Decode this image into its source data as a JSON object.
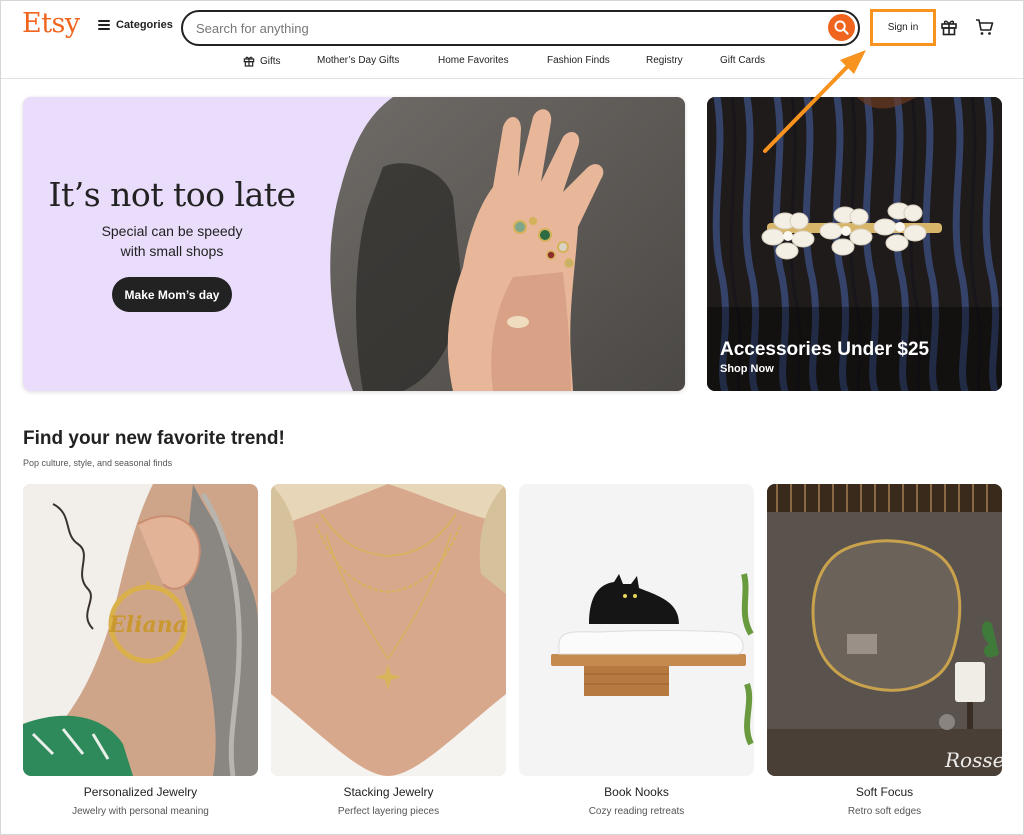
{
  "header": {
    "logo": "Etsy",
    "categories_label": "Categories",
    "search_placeholder": "Search for anything",
    "sign_in": "Sign in"
  },
  "nav": {
    "items": [
      "Gifts",
      "Mother’s Day Gifts",
      "Home Favorites",
      "Fashion Finds",
      "Registry",
      "Gift Cards"
    ]
  },
  "hero": {
    "title": "It’s not too late",
    "subtitle_line1": "Special can be speedy",
    "subtitle_line2": "with small shops",
    "button": "Make Mom’s day"
  },
  "side_promo": {
    "title": "Accessories Under $25",
    "cta": "Shop Now"
  },
  "trend": {
    "title": "Find your new favorite trend!",
    "subtitle": "Pop culture, style, and seasonal finds",
    "cards": [
      {
        "label": "Personalized Jewelry",
        "desc": "Jewelry with personal meaning",
        "engraved": "Eliana"
      },
      {
        "label": "Stacking Jewelry",
        "desc": "Perfect layering pieces"
      },
      {
        "label": "Book Nooks",
        "desc": "Cozy reading retreats"
      },
      {
        "label": "Soft Focus",
        "desc": "Retro soft edges",
        "watermark": "Rosse"
      }
    ]
  },
  "colors": {
    "brand_orange": "#f1641e",
    "highlight": "#f7931e",
    "hero_lavender": "#e9ddfb",
    "dark_button": "#222222"
  },
  "icons": [
    "menu-icon",
    "search-icon",
    "gift-icon",
    "cart-icon"
  ]
}
